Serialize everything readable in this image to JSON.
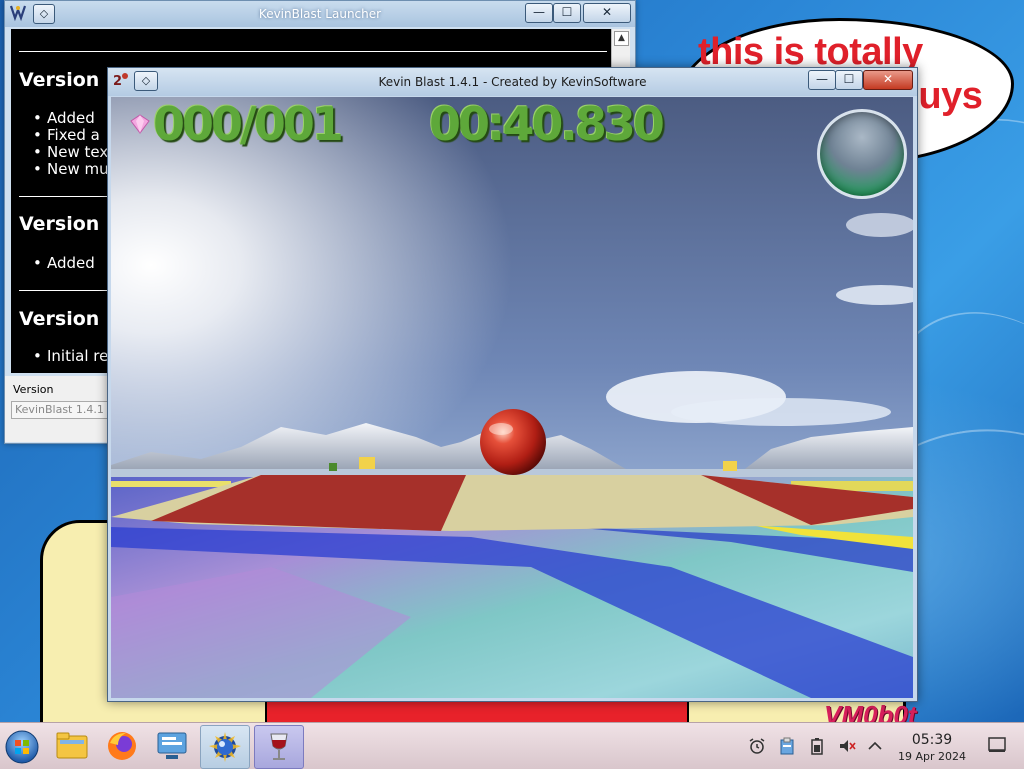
{
  "desktop": {
    "bubble_text": "this is totally windows 7 guys",
    "watermark": "VM0b0t"
  },
  "launcher": {
    "title": "KevinBlast Launcher",
    "sections": [
      {
        "heading": "Version 1",
        "items": [
          "Added",
          "Fixed a",
          "New tex",
          "New mu"
        ]
      },
      {
        "heading": "Version 1",
        "items": [
          "Added"
        ]
      },
      {
        "heading": "Version 1",
        "items": [
          "Initial re"
        ]
      }
    ],
    "version_label": "Version",
    "version_value": "KevinBlast 1.4.1",
    "buttons": {
      "minimize": "—",
      "maximize": "☐",
      "close": "✕",
      "pin": "◇"
    }
  },
  "game": {
    "title": "Kevin Blast 1.4.1 - Created by KevinSoftware",
    "gem_counter": "000/001",
    "timer": "00:40.830",
    "buttons": {
      "minimize": "—",
      "maximize": "☐",
      "close": "✕",
      "pin": "◇"
    }
  },
  "taskbar": {
    "apps": [
      {
        "name": "file-manager",
        "state": "normal"
      },
      {
        "name": "firefox",
        "state": "normal"
      },
      {
        "name": "network-settings",
        "state": "normal"
      },
      {
        "name": "kevinblast-launcher",
        "state": "active"
      },
      {
        "name": "wine-game",
        "state": "running"
      }
    ],
    "tray": [
      "alarm-icon",
      "clipboard-icon",
      "battery-icon",
      "volume-muted-icon",
      "chevron-up-icon"
    ],
    "clock_time": "05:39",
    "clock_date": "19 Apr 2024"
  },
  "colors": {
    "hud_green": "#5ea83a",
    "desktop_blue": "#2b86d6",
    "bubble_text": "#e0202a",
    "watermark": "#d8205c"
  }
}
